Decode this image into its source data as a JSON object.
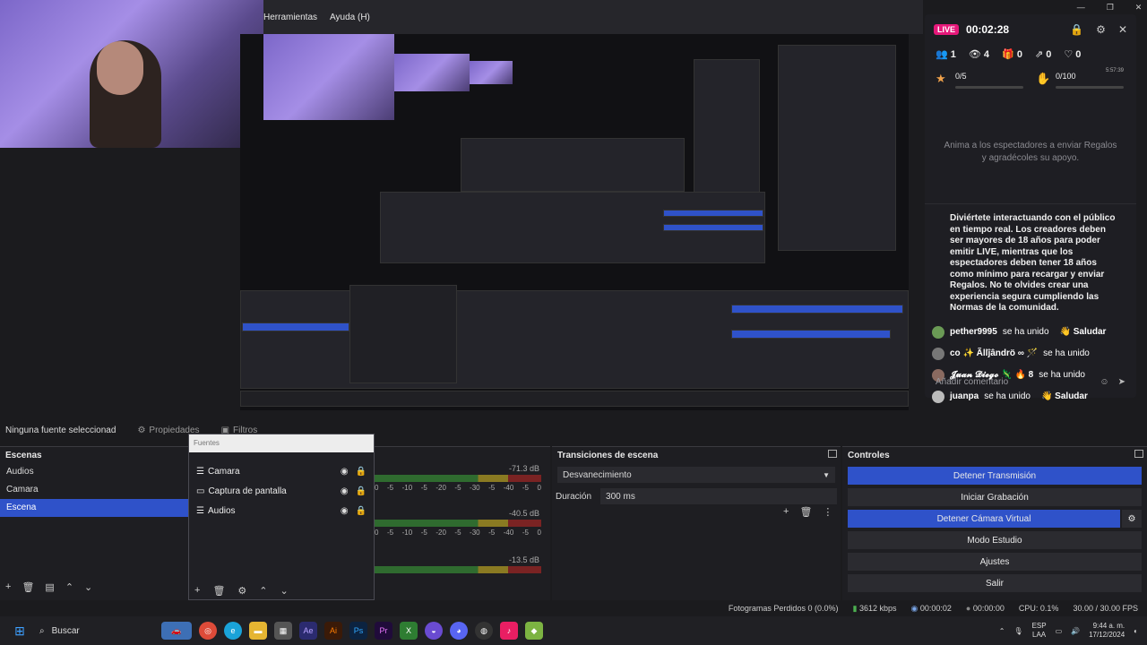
{
  "menu": [
    "Herramientas",
    "Ayuda (H)"
  ],
  "chat": {
    "live": "LIVE",
    "timer": "00:02:28",
    "stats": [
      {
        "icon": "people-icon",
        "value": "1"
      },
      {
        "icon": "eye-icon",
        "value": "4"
      },
      {
        "icon": "gift-icon",
        "value": "0"
      },
      {
        "icon": "share-icon",
        "value": "0"
      },
      {
        "icon": "heart-icon",
        "value": "0"
      }
    ],
    "goals": [
      {
        "value": "0/5",
        "time": ""
      },
      {
        "value": "0/100",
        "time": "5:57:39"
      }
    ],
    "invite": "Anima a los espectadores a enviar Regalos y agradécoles su apoyo.",
    "rules": "Diviértete interactuando con el público en tiempo real. Los creadores deben ser mayores de 18 años para poder emitir LIVE, mientras que los espectadores deben tener 18 años como mínimo para recargar y enviar Regalos. No te olvides crear una experiencia segura cumpliendo las Normas de la comunidad.",
    "messages": [
      {
        "user": "pether9995",
        "text": "se ha unido",
        "action": "👋 Saludar"
      },
      {
        "user": "co ✨ Ãllĵândrö ∞ 🪄",
        "text": "se ha unido",
        "action": ""
      },
      {
        "user": "𝓙𝓾𝓪𝓷 𝓓𝓲𝓮𝓰𝓸 🦎 🔥 8",
        "text": "se ha unido",
        "action": ""
      },
      {
        "user": "juanpa",
        "text": "se ha unido",
        "action": "👋 Saludar"
      }
    ],
    "input_placeholder": "Añadir comentario"
  },
  "source_toolbar": {
    "none_selected": "Ninguna fuente seleccionad",
    "properties": "Propiedades",
    "filters": "Filtros"
  },
  "scenes": {
    "title": "Escenas",
    "items": [
      "Audios",
      "Camara",
      "Escena"
    ],
    "selected": 2
  },
  "sources": {
    "header": "Fuentes",
    "items": [
      {
        "name": "Camara",
        "icon": "list-icon"
      },
      {
        "name": "Captura de pantalla",
        "icon": "monitor-icon"
      },
      {
        "name": "Audios",
        "icon": "list-icon"
      }
    ]
  },
  "mixer": {
    "levels": [
      "-71.3 dB",
      "-40.5 dB",
      "-13.5 dB"
    ],
    "ticks": [
      "0",
      "-5",
      "-10",
      "-5",
      "-20",
      "-5",
      "-30",
      "-5",
      "-40",
      "-5",
      "0"
    ]
  },
  "transitions": {
    "title": "Transiciones de escena",
    "type": "Desvanecimiento",
    "duration_label": "Duración",
    "duration": "300 ms"
  },
  "controls": {
    "title": "Controles",
    "buttons": [
      {
        "label": "Detener Transmisión",
        "active": true
      },
      {
        "label": "Iniciar Grabación",
        "active": false
      },
      {
        "label": "Detener Cámara Virtual",
        "active": true
      },
      {
        "label": "Modo Estudio",
        "active": false
      },
      {
        "label": "Ajustes",
        "active": false
      },
      {
        "label": "Salir",
        "active": false
      }
    ]
  },
  "status": {
    "dropped": "Fotogramas Perdidos 0 (0.0%)",
    "bitrate": "3612 kbps",
    "stream_time": "00:00:02",
    "rec_time": "00:00:00",
    "cpu": "CPU: 0.1%",
    "fps": "30.00 / 30.00 FPS"
  },
  "taskbar": {
    "search": "Buscar",
    "lang": "ESP",
    "region": "LAA",
    "time": "9:44 a. m.",
    "date": "17/12/2024"
  },
  "colors": {
    "accent": "#2f52c9",
    "live": "#e6187a"
  }
}
